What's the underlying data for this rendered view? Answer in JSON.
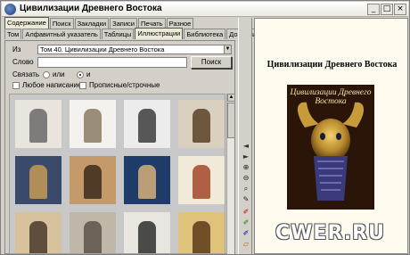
{
  "window": {
    "title": "Цивилизации Древнего Востока",
    "minimize_glyph": "_",
    "maximize_glyph": "□",
    "close_glyph": "×"
  },
  "tabs_top": [
    {
      "label": "Содержание",
      "active": true
    },
    {
      "label": "Поиск",
      "active": false
    },
    {
      "label": "Закладки",
      "active": false
    },
    {
      "label": "Записи",
      "active": false
    },
    {
      "label": "Печать",
      "active": false
    },
    {
      "label": "Разное",
      "active": false
    }
  ],
  "tabs_sub": [
    {
      "label": "Том",
      "active": false
    },
    {
      "label": "Алфавитный указатель",
      "active": false
    },
    {
      "label": "Таблицы",
      "active": false
    },
    {
      "label": "Иллюстрации",
      "active": true
    },
    {
      "label": "Библиотека",
      "active": false
    },
    {
      "label": "Дополнительно",
      "active": false
    }
  ],
  "search_form": {
    "from_label": "Из",
    "from_value": "Том 40. Цивилизации Древнего Востока",
    "word_label": "Слово",
    "word_value": "",
    "search_button": "Поиск",
    "link_label": "Связать",
    "radio_or": "или",
    "radio_and": "и",
    "radio_selected": "and",
    "check_any_spelling": "Любое написание",
    "check_case": "Прописные/строчные"
  },
  "thumbnails": [
    {
      "name": "thumb-interior-sketch",
      "bg": "#e9e4dc",
      "accent": "#6a6a6a"
    },
    {
      "name": "thumb-stone-tower",
      "bg": "#f4f2ee",
      "accent": "#8c7b62"
    },
    {
      "name": "thumb-relief-figures",
      "bg": "#ececec",
      "accent": "#3d3d3d"
    },
    {
      "name": "thumb-bronze-figure",
      "bg": "#d9d0c0",
      "accent": "#5b4128"
    },
    {
      "name": "thumb-mosaic-panel",
      "bg": "#3a4a6a",
      "accent": "#c79a55"
    },
    {
      "name": "thumb-banquet-scene",
      "bg": "#c59a6a",
      "accent": "#3a2a1a"
    },
    {
      "name": "thumb-standard-of-ur",
      "bg": "#1f3b6a",
      "accent": "#d7b07a"
    },
    {
      "name": "thumb-painted-vase",
      "bg": "#f1ead8",
      "accent": "#a6472a"
    },
    {
      "name": "thumb-worshipper-statues",
      "bg": "#d8c29c",
      "accent": "#4a3a2a"
    },
    {
      "name": "thumb-carved-stone",
      "bg": "#bfb7a8",
      "accent": "#5c554a"
    },
    {
      "name": "thumb-seated-statue",
      "bg": "#e9e6df",
      "accent": "#2e2e2e"
    },
    {
      "name": "thumb-standing-figure",
      "bg": "#e0c27a",
      "accent": "#5c3a1a"
    }
  ],
  "toolbar_icons": [
    {
      "name": "nav-prev-icon",
      "glyph": "◄"
    },
    {
      "name": "nav-next-icon",
      "glyph": "►"
    },
    {
      "name": "zoom-in-icon",
      "glyph": "⊕"
    },
    {
      "name": "zoom-out-icon",
      "glyph": "⊖"
    },
    {
      "name": "find-icon",
      "glyph": "⌕"
    },
    {
      "name": "pen-icon",
      "glyph": "✎"
    },
    {
      "name": "marker-red-icon",
      "glyph": "✐"
    },
    {
      "name": "marker-green-icon",
      "glyph": "✐"
    },
    {
      "name": "marker-blue-icon",
      "glyph": "✐"
    },
    {
      "name": "eraser-icon",
      "glyph": "▱"
    }
  ],
  "document": {
    "heading": "Цивилизации Древнего Востока",
    "cover_title": "Цивилизации Древнего Востока"
  },
  "watermark": "CWER.RU"
}
